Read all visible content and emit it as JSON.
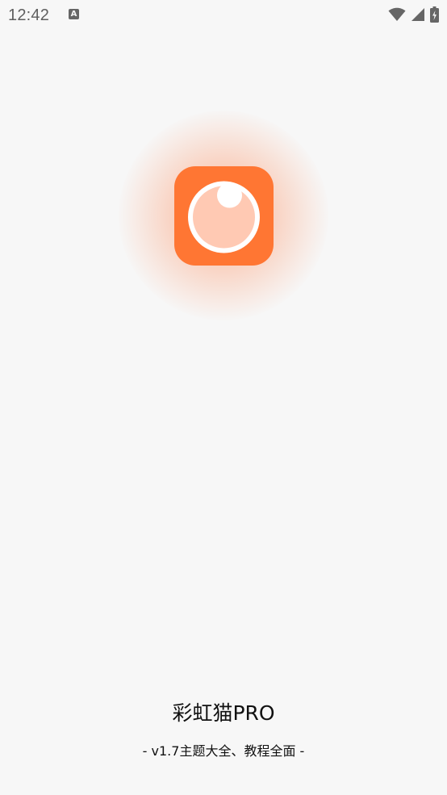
{
  "status_bar": {
    "time": "12:42",
    "notification_icon_letter": "A",
    "icons": [
      "wifi-icon",
      "cellular-signal-icon",
      "battery-charging-icon"
    ]
  },
  "splash": {
    "logo_icon": "camera-lens-icon",
    "brand_color": "#ff7633",
    "app_name": "彩虹猫PRO",
    "tagline": "- v1.7主题大全、教程全面 -"
  }
}
